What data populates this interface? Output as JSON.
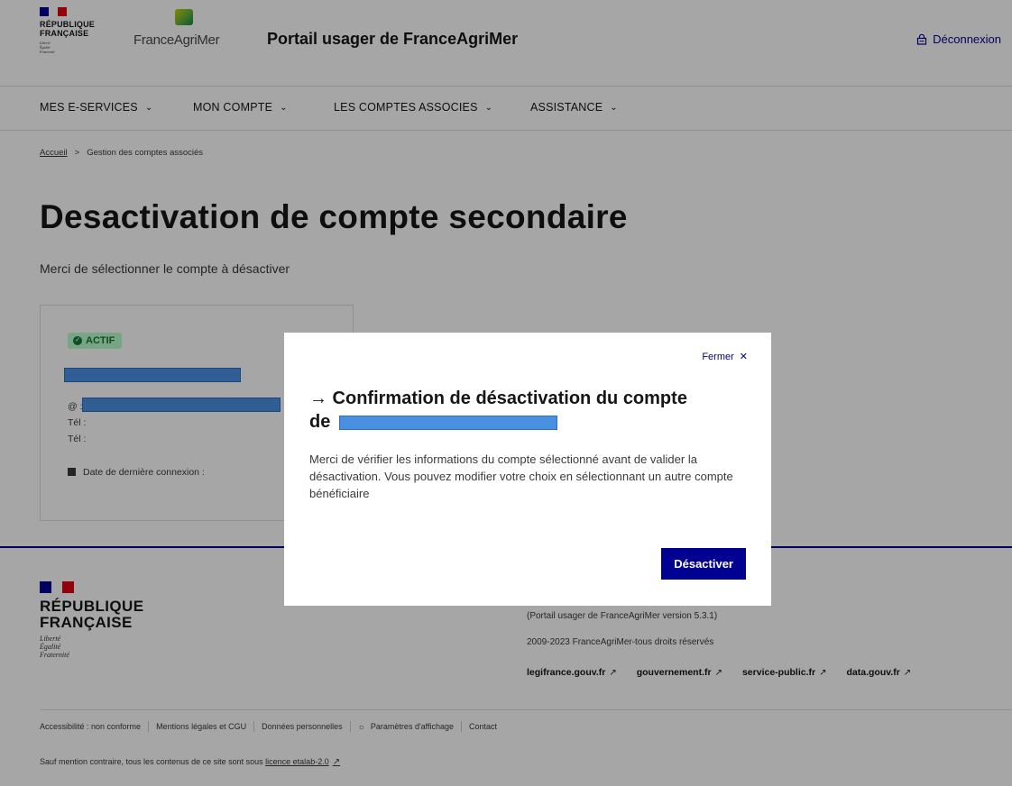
{
  "header": {
    "rf_lines": [
      "RÉPUBLIQUE",
      "FRANÇAISE"
    ],
    "rf_motto": [
      "Liberté",
      "Égalité",
      "Fraternité"
    ],
    "fam_logo_text": "FranceAgriMer",
    "portal_title": "Portail usager de FranceAgriMer",
    "logout_label": "Déconnexion"
  },
  "nav": {
    "items": [
      {
        "label": "MES E-SERVICES"
      },
      {
        "label": "MON COMPTE"
      },
      {
        "label": "LES COMPTES ASSOCIES"
      },
      {
        "label": "ASSISTANCE"
      }
    ]
  },
  "breadcrumb": {
    "home": "Accueil",
    "separator": ">",
    "current": "Gestion des comptes associés"
  },
  "page": {
    "title": "Desactivation de compte secondaire",
    "subtitle": "Merci de sélectionner le compte à désactiver"
  },
  "card": {
    "status": "ACTIF",
    "email_label": "@ :",
    "tel1_label": "Tél :",
    "tel2_label": "Tél :",
    "last_login_label": "Date de dernière connexion :"
  },
  "modal": {
    "close_label": "Fermer",
    "title_line1": "→ Confirmation de désactivation du compte",
    "title_prefix": "de",
    "body": "Merci de vérifier les informations du compte sélectionné avant de valider la désactivation. Vous pouvez modifier votre choix en sélectionnant un autre compte bénéficiaire",
    "confirm_label": "Désactiver"
  },
  "footer": {
    "rf_lines": [
      "RÉPUBLIQUE",
      "FRANÇAISE"
    ],
    "rf_motto": [
      "Liberté",
      "Égalité",
      "Fraternité"
    ],
    "version": "(Portail usager de FranceAgriMer version 5.3.1)",
    "copyright": "2009-2023 FranceAgriMer-tous droits réservés",
    "links": [
      "legifrance.gouv.fr",
      "gouvernement.fr",
      "service-public.fr",
      "data.gouv.fr"
    ],
    "bottom_links": [
      "Accessibilité : non conforme",
      "Mentions légales et CGU",
      "Données personnelles",
      "Paramètres d'affichage",
      "Contact"
    ],
    "licence_prefix": "Sauf mention contraire, tous les contenus de ce site sont sous",
    "licence_link": "licence etalab-2.0"
  },
  "colors": {
    "primary": "#000091",
    "marianne_red": "#e1000f",
    "status_green": "#18753c",
    "status_green_bg": "#b8fec9",
    "redaction_blue": "#4a90e2"
  }
}
